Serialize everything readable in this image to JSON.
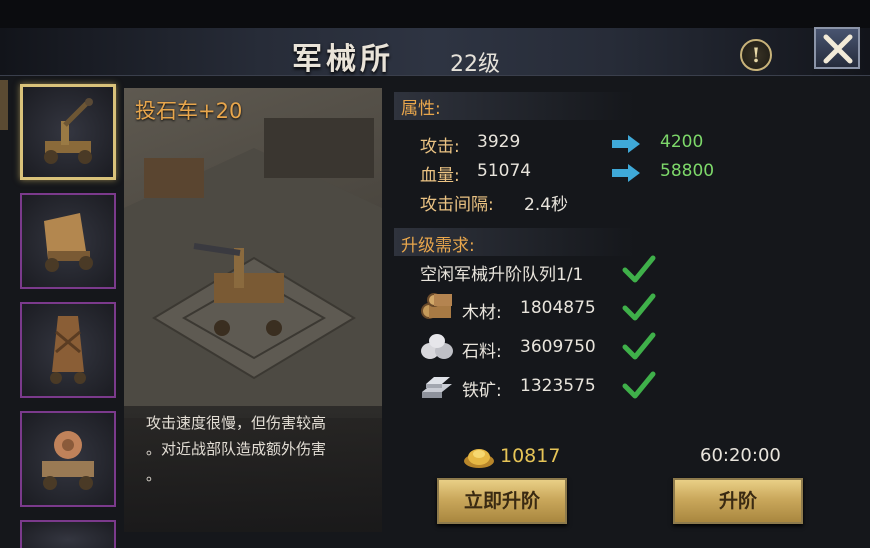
{
  "header": {
    "title": "军械所",
    "level": "22级"
  },
  "preview": {
    "weapon_name": "投石车+20",
    "description_lines": [
      "攻击速度很慢，但伤害较高",
      "。对近战部队造成额外伤害",
      "。"
    ]
  },
  "attributes": {
    "section_label": "属性:",
    "attack": {
      "label": "攻击:",
      "current": "3929",
      "next": "4200"
    },
    "hp": {
      "label": "血量:",
      "current": "51074",
      "next": "58800"
    },
    "interval": {
      "label": "攻击间隔:",
      "value": "2.4秒"
    }
  },
  "requirements": {
    "section_label": "升级需求:",
    "queue": "空闲军械升阶队列1/1",
    "wood": {
      "label": "木材:",
      "value": "1804875"
    },
    "stone": {
      "label": "石料:",
      "value": "3609750"
    },
    "iron": {
      "label": "铁矿:",
      "value": "1323575"
    }
  },
  "footer": {
    "gold_cost": "10817",
    "time": "60:20:00",
    "instant_button": "立即升阶",
    "upgrade_button": "升阶"
  },
  "thumbnails": [
    "catapult",
    "battering-ram",
    "siege-tower",
    "ballista"
  ],
  "colors": {
    "accent_orange": "#e8a64c",
    "upgrade_green": "#7dd86a",
    "selected_border": "#d9c27a",
    "thumb_border": "#7b3a8c",
    "arrow_blue": "#3fa9d8",
    "check_green": "#3fb04a"
  }
}
